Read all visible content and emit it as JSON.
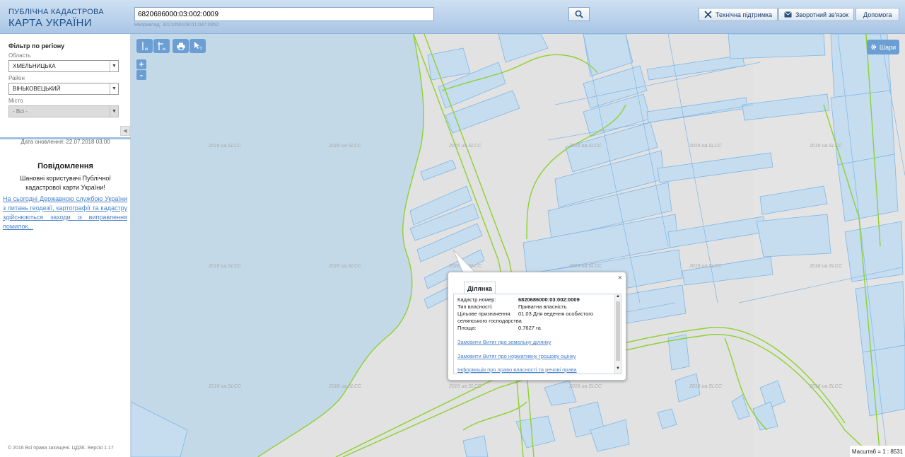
{
  "header": {
    "logo_line1": "ПУБЛІЧНА КАДАСТРОВА",
    "logo_line2": "КАРТА УКРАЇНИ",
    "search_value": "6820686000:03:002:0009",
    "search_hint": "Наприклад: 3221055108:01:047:0052",
    "search_icon": "search-icon",
    "buttons": {
      "support": "Технічна підтримка",
      "feedback": "Зворотний зв'язок",
      "help": "Допомога"
    }
  },
  "sidebar": {
    "filter_title": "Фільтр по регіону",
    "region_label": "Область",
    "region_value": "ХМЕЛЬНИЦЬКА",
    "district_label": "Район",
    "district_value": "ВІНЬКОВЕЦЬКИЙ",
    "city_label": "Місто",
    "city_value": "- Всі -",
    "updated": "Дата оновлення: 22.07.2018 03:00",
    "notice_title": "Повідомлення",
    "notice_text": "Шановні користувачі Публічної кадастрової карти України!",
    "notice_link": "На сьогодні Державною службою України з питань геодезії, картографії та кадастру здійснюються заходи із виправлення помилок...",
    "copyright": "© 2016 Всі права захищені. ЦДЗК. Версія 1.17"
  },
  "map": {
    "layers_label": "Шари",
    "zoom_in": "+",
    "zoom_out": "-",
    "scale": "Масштаб = 1 : 8531",
    "watermark": "2016 ua.SLCC",
    "colors": {
      "water": "#c4d9e8",
      "parcel_fill": "#c6dcef",
      "parcel_stroke": "#7fb7e6",
      "boundary": "#8dd230"
    }
  },
  "popup": {
    "tab": "Ділянка",
    "close": "×",
    "rows": [
      {
        "label": "Кадастр.номер:",
        "value": "6820686000:03:002:0009"
      },
      {
        "label": "Тип власності:",
        "value": "Приватна власність"
      },
      {
        "label": "Цільове призначення:",
        "value": "01.03 Для ведення особистого"
      },
      {
        "label": "",
        "value": "селянського господарства"
      },
      {
        "label": "Площа:",
        "value": "0.7627 га"
      }
    ],
    "links": [
      "Замовити Витяг про земельну ділянку",
      "Замовити Витяг про нормативну грошову оцінку",
      "Інформація про право власності та речові права"
    ]
  }
}
